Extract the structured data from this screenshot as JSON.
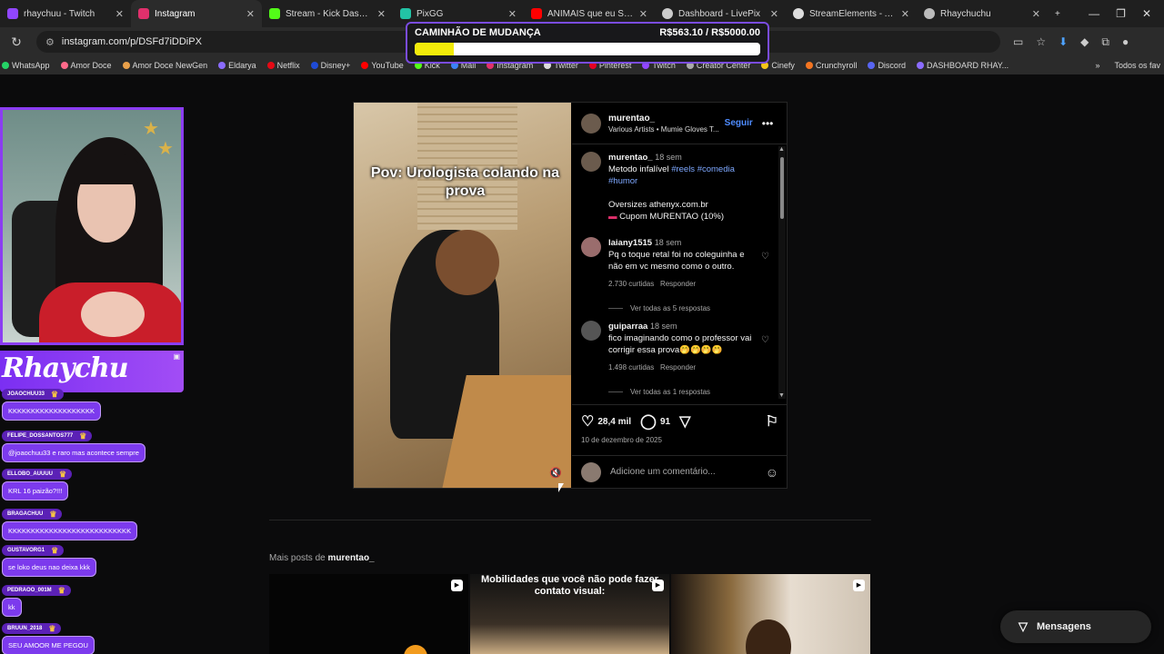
{
  "browser": {
    "tabs": [
      {
        "label": "rhaychuu - Twitch",
        "color": "#9146ff"
      },
      {
        "label": "Instagram",
        "color": "#e1306c",
        "active": true
      },
      {
        "label": "Stream - Kick Dashboard",
        "color": "#53fc18"
      },
      {
        "label": "PixGG",
        "color": "#22c3a5"
      },
      {
        "label": "ANIMAIS que eu SAIRIA",
        "color": "#ff0000"
      },
      {
        "label": "Dashboard - LivePix",
        "color": "#cccccc"
      },
      {
        "label": "StreamElements - Activit",
        "color": "#dddddd"
      },
      {
        "label": "Rhaychuchu",
        "color": "#bbbbbb"
      }
    ],
    "url": "instagram.com/p/DSFd7iDDiPX",
    "bookmarks": [
      {
        "label": "WhatsApp",
        "color": "#25d366"
      },
      {
        "label": "Amor Doce",
        "color": "#ff6a8a"
      },
      {
        "label": "Amor Doce NewGen",
        "color": "#e9a04a"
      },
      {
        "label": "Eldarya",
        "color": "#8b6cff"
      },
      {
        "label": "Netflix",
        "color": "#e50914"
      },
      {
        "label": "Disney+",
        "color": "#1f4bd6"
      },
      {
        "label": "YouTube",
        "color": "#ff0000"
      },
      {
        "label": "Kick",
        "color": "#53fc18"
      },
      {
        "label": "Mail",
        "color": "#3b82f6"
      },
      {
        "label": "Instagram",
        "color": "#e1306c"
      },
      {
        "label": "Twitter",
        "color": "#dddddd"
      },
      {
        "label": "Pinterest",
        "color": "#e60023"
      },
      {
        "label": "Twitch",
        "color": "#9146ff"
      },
      {
        "label": "Creator Center",
        "color": "#aaaaaa"
      },
      {
        "label": "Cinefy",
        "color": "#f5c518"
      },
      {
        "label": "Crunchyroll",
        "color": "#f47521"
      },
      {
        "label": "Discord",
        "color": "#5865f2"
      },
      {
        "label": "DASHBOARD RHAY...",
        "color": "#8b6cff"
      }
    ],
    "bookmarks_all": "Todos os fav"
  },
  "goal": {
    "title": "CAMINHÃO DE MUDANÇA",
    "amount": "R$563.10 / R$5000.00",
    "progress": 0.113
  },
  "stream": {
    "banner_name": "Rhaychu",
    "chat": [
      {
        "user": "JOAOCHUU33",
        "text": "KKKKKKKKKKKKKKKKKKK"
      },
      {
        "user": "FELIPE_DOSSANTOS777",
        "text": "@joaochuu33 e raro mas acontece sempre"
      },
      {
        "user": "ELLOBO_AUUUU",
        "text": "KRL 16 paizão?!!!"
      },
      {
        "user": "BRAGACHUU",
        "text": "KKKKKKKKKKKKKKKKKKKKKKKKKKK"
      },
      {
        "user": "GUSTAVORG1",
        "text": "se loko deus nao deixa kkk"
      },
      {
        "user": "PEDRAOO_001M",
        "text": "kk"
      },
      {
        "user": "BRUUN_2018",
        "text": "SEU AMOOR ME PEGOU"
      }
    ]
  },
  "post": {
    "caption_overlay": "Pov: Urologista colando na prova",
    "author": "murentao_",
    "audio": "Various Artists • Mumie Gloves T...",
    "follow_label": "Seguir",
    "main_comment": {
      "user": "murentao_",
      "time": "18 sem",
      "text": "Metodo infalível",
      "tags": "#reels #comedia #humor",
      "extra1": "Oversizes athenyx.com.br",
      "extra2": "Cupom MURENTAO (10%)"
    },
    "comments": [
      {
        "user": "laiany1515",
        "time": "18 sem",
        "text": "Pq o toque retal foi no coleguinha e não em vc mesmo como o outro.",
        "likes": "2.730 curtidas",
        "reply": "Responder",
        "view_replies": "Ver todas as 5 respostas"
      },
      {
        "user": "guiparraa",
        "time": "18 sem",
        "text": "fico imaginando como o professor vai corrigir essa prova🤭🤭🤭🤭",
        "likes": "1.498 curtidas",
        "reply": "Responder",
        "view_replies": "Ver todas as 1 respostas"
      }
    ],
    "like_count": "28,4 mil",
    "comment_count": "91",
    "date": "10 de dezembro de 2025",
    "add_comment_placeholder": "Adicione um comentário..."
  },
  "more_posts": {
    "prefix": "Mais posts de",
    "author": "murentao_",
    "thumb2_text": "Mobilidades que você não pode fazer contato visual:"
  },
  "messages_label": "Mensagens"
}
